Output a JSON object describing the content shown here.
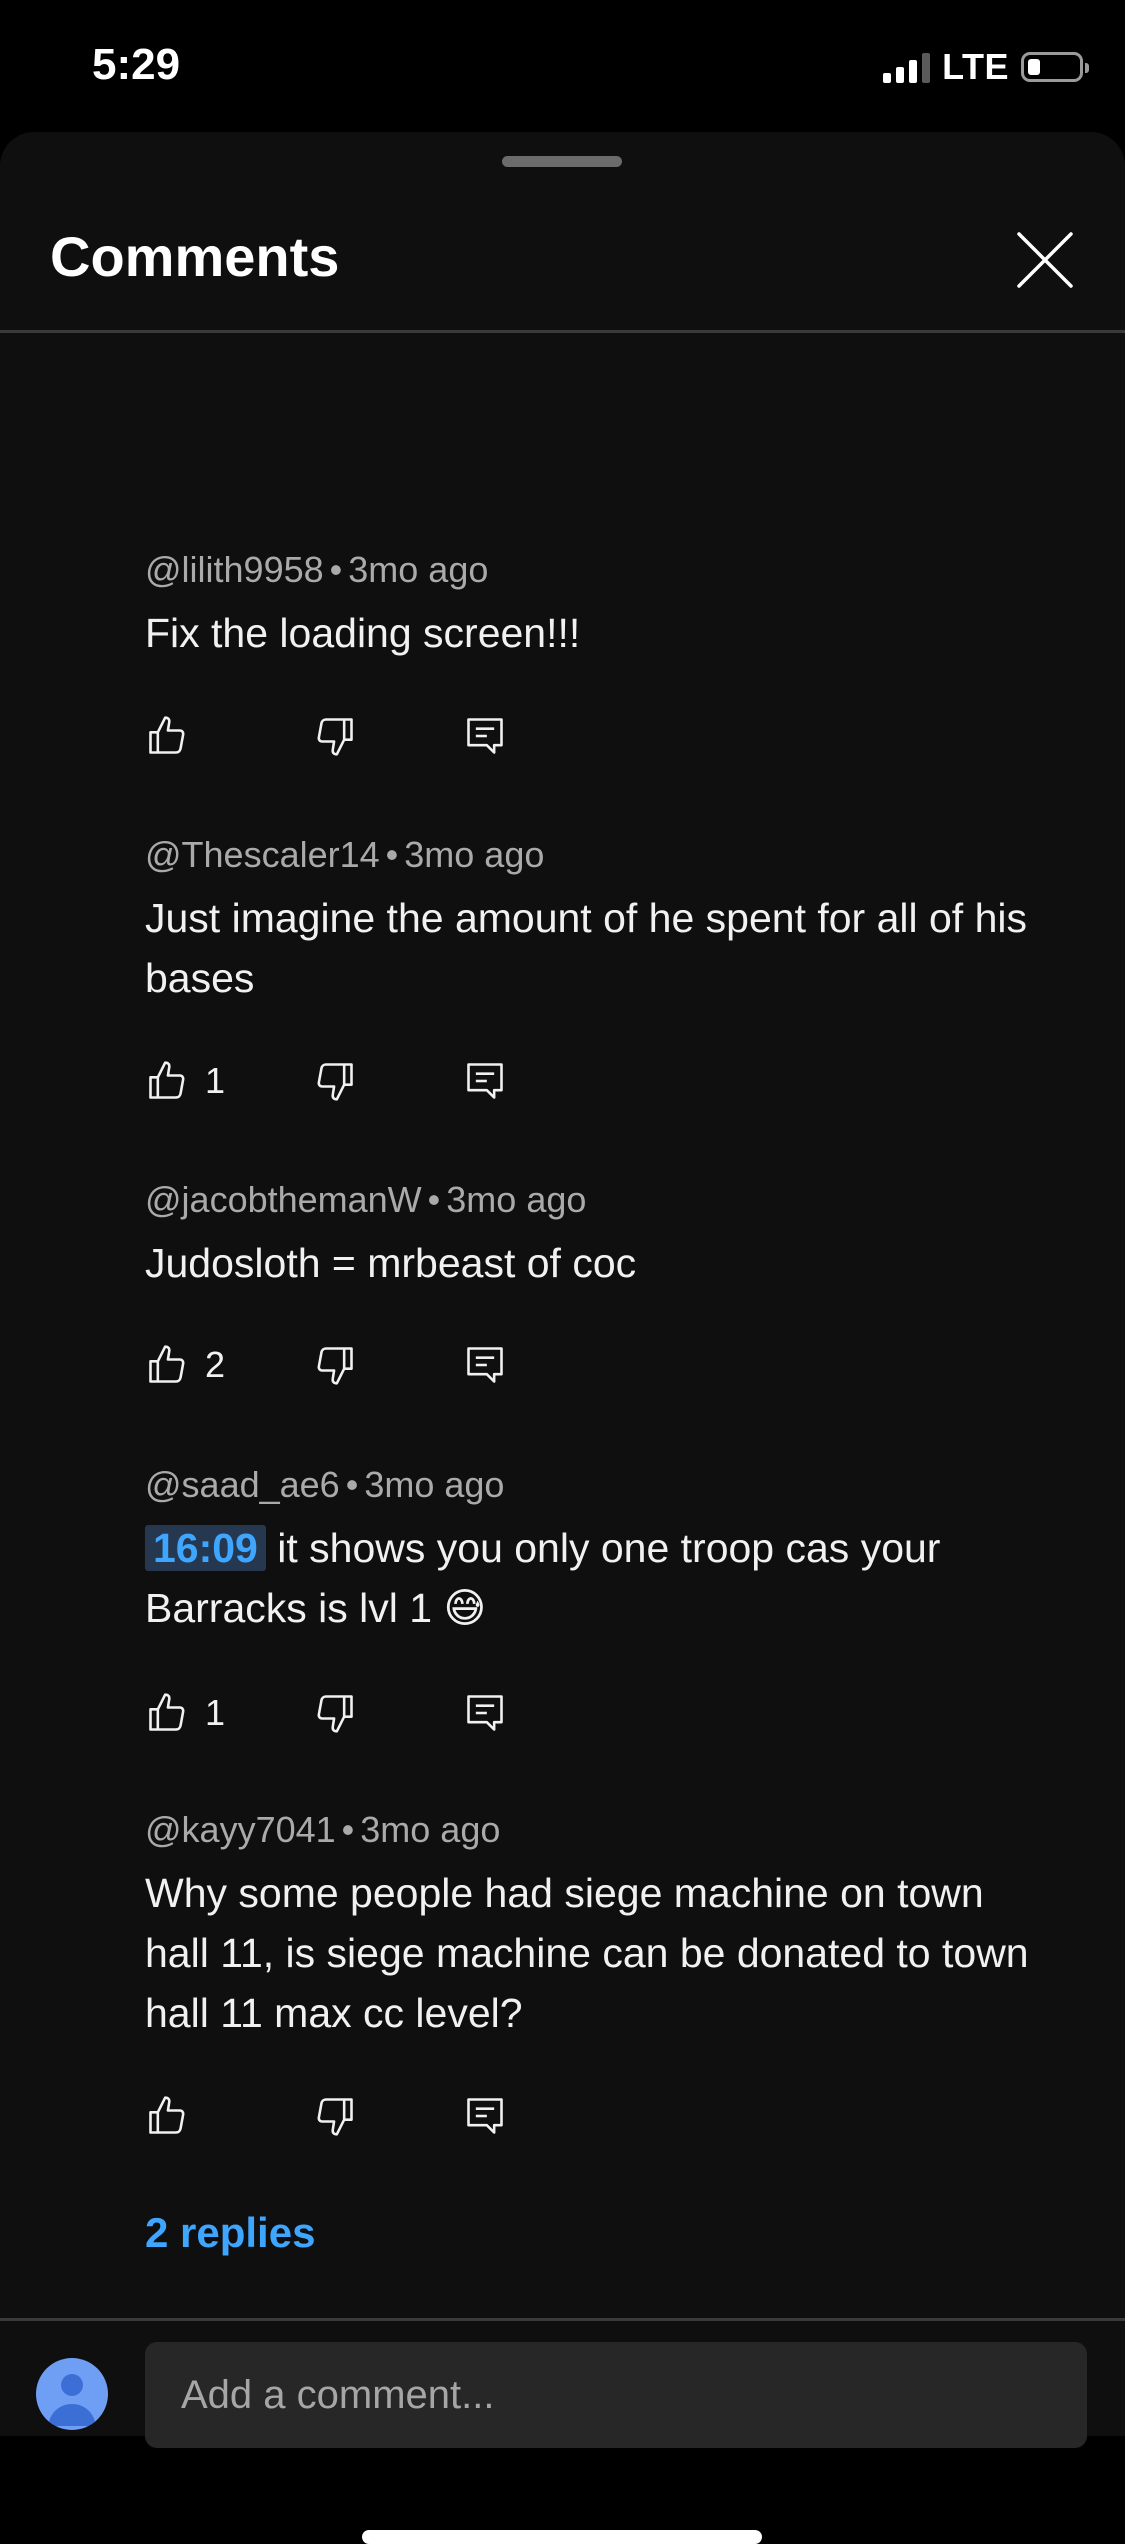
{
  "status_bar": {
    "time": "5:29",
    "network": "LTE",
    "icons": [
      "cellular-signal-icon",
      "battery-icon"
    ]
  },
  "sheet": {
    "title": "Comments",
    "close_icon": "close-icon"
  },
  "comments": [
    {
      "author": "@lilith9958",
      "separator": "•",
      "age": "3mo ago",
      "text": "Fix the loading screen!!!",
      "likes": ""
    },
    {
      "author": "@Thescaler14",
      "separator": "•",
      "age": "3mo ago",
      "text": "Just imagine the amount of he spent for all of his bases",
      "likes": "1"
    },
    {
      "author": "@jacobthemanW",
      "separator": "•",
      "age": "3mo ago",
      "text": "Judosloth = mrbeast of coc",
      "likes": "2"
    },
    {
      "author": "@saad_ae6",
      "separator": "•",
      "age": "3mo ago",
      "timestamp": "16:09",
      "text": " it shows you only one troop cas your Barracks is lvl 1 😅",
      "likes": "1"
    },
    {
      "author": "@kayy7041",
      "separator": "•",
      "age": "3mo ago",
      "text": "Why some people had siege machine on town hall 11, is siege machine can be donated to town hall 11 max cc level?",
      "likes": ""
    }
  ],
  "replies_link": "2 replies",
  "comment_box": {
    "placeholder": "Add a comment...",
    "avatar_icon": "user-avatar-icon"
  },
  "colors": {
    "background": "#0f0f0f",
    "accent_link": "#3ea6ff",
    "input_bg": "#272727",
    "avatar": "#6f9ff5"
  }
}
